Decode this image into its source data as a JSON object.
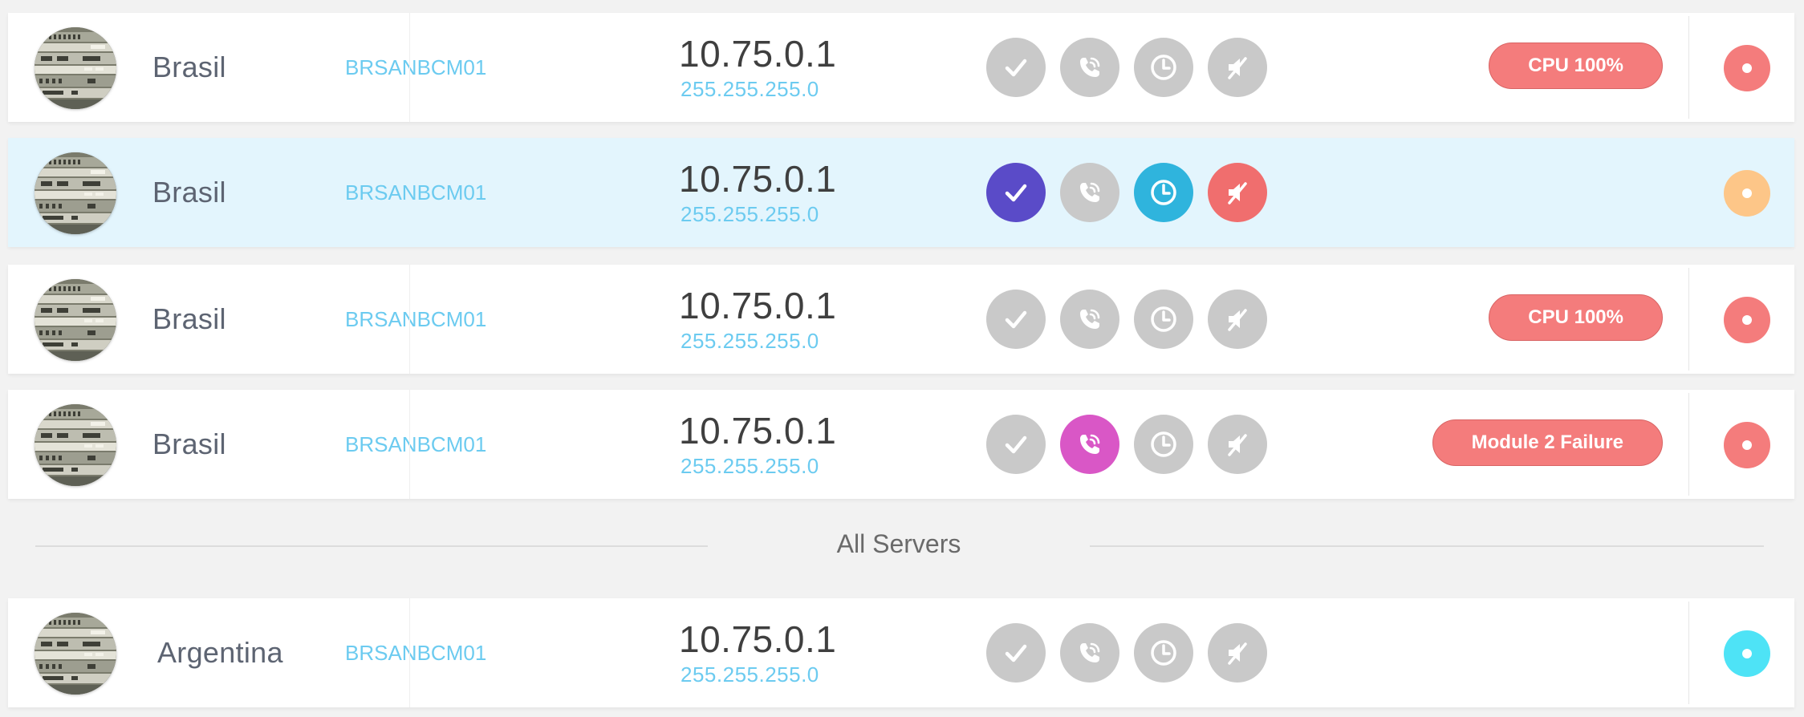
{
  "colors": {
    "icon_inactive": "#c9c9c9",
    "check_active": "#5a4bc8",
    "phone_active": "#d957c6",
    "clock_active": "#2fb4dd",
    "mute_active": "#f06e6e",
    "status_red": "#f47c7c",
    "status_orange": "#fdc688",
    "status_cyan": "#4ee3f6",
    "badge_bg": "#f47c7c",
    "link_blue": "#6ccbf0"
  },
  "servers": [
    {
      "country": "Brasil",
      "hostname": "BRSANBCM01",
      "ip": "10.75.0.1",
      "mask": "255.255.255.0",
      "badge": "CPU 100%",
      "status_color": "#f47c7c",
      "selected": false,
      "actions": [
        {
          "icon": "check-icon",
          "active": false
        },
        {
          "icon": "phone-icon",
          "active": false
        },
        {
          "icon": "clock-icon",
          "active": false
        },
        {
          "icon": "mute-icon",
          "active": false
        }
      ]
    },
    {
      "country": "Brasil",
      "hostname": "BRSANBCM01",
      "ip": "10.75.0.1",
      "mask": "255.255.255.0",
      "badge": "",
      "status_color": "#fdc688",
      "selected": true,
      "actions": [
        {
          "icon": "check-icon",
          "active": true
        },
        {
          "icon": "phone-icon",
          "active": false
        },
        {
          "icon": "clock-icon",
          "active": true
        },
        {
          "icon": "mute-icon",
          "active": true
        }
      ]
    },
    {
      "country": "Brasil",
      "hostname": "BRSANBCM01",
      "ip": "10.75.0.1",
      "mask": "255.255.255.0",
      "badge": "CPU 100%",
      "status_color": "#f47c7c",
      "selected": false,
      "actions": [
        {
          "icon": "check-icon",
          "active": false
        },
        {
          "icon": "phone-icon",
          "active": false
        },
        {
          "icon": "clock-icon",
          "active": false
        },
        {
          "icon": "mute-icon",
          "active": false
        }
      ]
    },
    {
      "country": "Brasil",
      "hostname": "BRSANBCM01",
      "ip": "10.75.0.1",
      "mask": "255.255.255.0",
      "badge": "Module 2 Failure",
      "status_color": "#f47c7c",
      "selected": false,
      "actions": [
        {
          "icon": "check-icon",
          "active": false
        },
        {
          "icon": "phone-icon",
          "active": true
        },
        {
          "icon": "clock-icon",
          "active": false
        },
        {
          "icon": "mute-icon",
          "active": false
        }
      ]
    }
  ],
  "separator": {
    "label": "All Servers"
  },
  "all_servers": [
    {
      "country": "Argentina",
      "hostname": "BRSANBCM01",
      "ip": "10.75.0.1",
      "mask": "255.255.255.0",
      "badge": "",
      "status_color": "#4ee3f6",
      "selected": false,
      "actions": [
        {
          "icon": "check-icon",
          "active": false
        },
        {
          "icon": "phone-icon",
          "active": false
        },
        {
          "icon": "clock-icon",
          "active": false
        },
        {
          "icon": "mute-icon",
          "active": false
        }
      ]
    }
  ]
}
